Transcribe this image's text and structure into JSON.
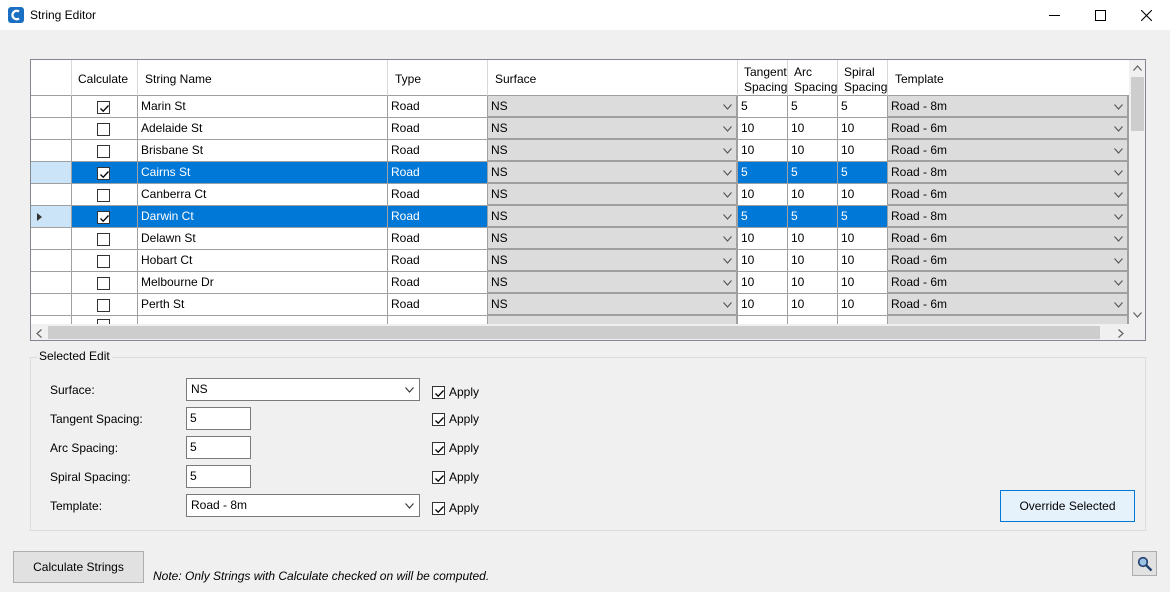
{
  "window": {
    "title": "String Editor"
  },
  "grid": {
    "headers": {
      "calculate": "Calculate",
      "string_name": "String Name",
      "type": "Type",
      "surface": "Surface",
      "tangent_1": "Tangent",
      "tangent_2": "Spacing",
      "arc_1": "Arc",
      "arc_2": "Spacing",
      "spiral_1": "Spiral",
      "spiral_2": "Spacing",
      "template": "Template"
    },
    "rows": [
      {
        "calculate": true,
        "name": "Marin St",
        "type": "Road",
        "surface": "NS",
        "tangent": "5",
        "arc": "5",
        "spiral": "5",
        "template": "Road - 8m",
        "selected": false,
        "current": false
      },
      {
        "calculate": false,
        "name": "Adelaide St",
        "type": "Road",
        "surface": "NS",
        "tangent": "10",
        "arc": "10",
        "spiral": "10",
        "template": "Road - 6m",
        "selected": false,
        "current": false
      },
      {
        "calculate": false,
        "name": "Brisbane St",
        "type": "Road",
        "surface": "NS",
        "tangent": "10",
        "arc": "10",
        "spiral": "10",
        "template": "Road - 6m",
        "selected": false,
        "current": false
      },
      {
        "calculate": true,
        "name": "Cairns St",
        "type": "Road",
        "surface": "NS",
        "tangent": "5",
        "arc": "5",
        "spiral": "5",
        "template": "Road - 8m",
        "selected": true,
        "current": false
      },
      {
        "calculate": false,
        "name": "Canberra Ct",
        "type": "Road",
        "surface": "NS",
        "tangent": "10",
        "arc": "10",
        "spiral": "10",
        "template": "Road - 6m",
        "selected": false,
        "current": false
      },
      {
        "calculate": true,
        "name": "Darwin Ct",
        "type": "Road",
        "surface": "NS",
        "tangent": "5",
        "arc": "5",
        "spiral": "5",
        "template": "Road - 8m",
        "selected": true,
        "current": true
      },
      {
        "calculate": false,
        "name": "Delawn St",
        "type": "Road",
        "surface": "NS",
        "tangent": "10",
        "arc": "10",
        "spiral": "10",
        "template": "Road - 6m",
        "selected": false,
        "current": false
      },
      {
        "calculate": false,
        "name": "Hobart Ct",
        "type": "Road",
        "surface": "NS",
        "tangent": "10",
        "arc": "10",
        "spiral": "10",
        "template": "Road - 6m",
        "selected": false,
        "current": false
      },
      {
        "calculate": false,
        "name": "Melbourne Dr",
        "type": "Road",
        "surface": "NS",
        "tangent": "10",
        "arc": "10",
        "spiral": "10",
        "template": "Road - 6m",
        "selected": false,
        "current": false
      },
      {
        "calculate": false,
        "name": "Perth St",
        "type": "Road",
        "surface": "NS",
        "tangent": "10",
        "arc": "10",
        "spiral": "10",
        "template": "Road - 6m",
        "selected": false,
        "current": false
      }
    ]
  },
  "selected_edit": {
    "title": "Selected Edit",
    "surface_label": "Surface:",
    "surface_value": "NS",
    "tangent_label": "Tangent Spacing:",
    "tangent_value": "5",
    "arc_label": "Arc Spacing:",
    "arc_value": "5",
    "spiral_label": "Spiral Spacing:",
    "spiral_value": "5",
    "template_label": "Template:",
    "template_value": "Road - 8m",
    "apply_label": "Apply",
    "apply_checked": [
      true,
      true,
      true,
      true,
      true
    ],
    "override_button": "Override Selected"
  },
  "footer": {
    "calculate_button": "Calculate Strings",
    "note": "Note: Only Strings with Calculate checked on will be computed."
  },
  "colors": {
    "selection": "#0078d7",
    "row_header_selected": "#cce4f7",
    "combo_bg": "#dcdcdc"
  }
}
